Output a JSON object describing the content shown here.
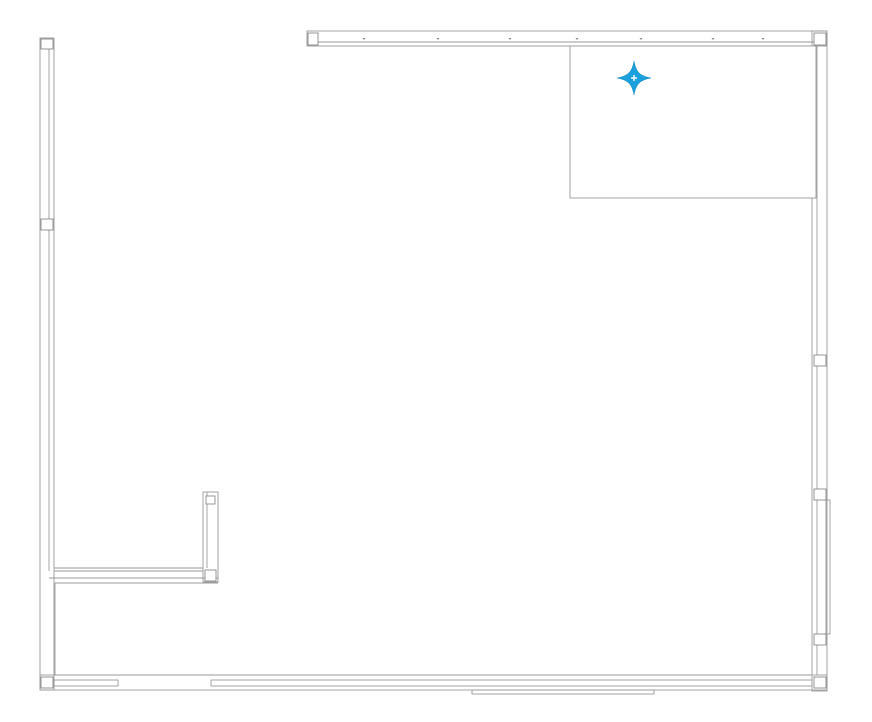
{
  "drawing": {
    "wall_color": "#9a9a9a",
    "column_color": "#8a8a8a",
    "background_color": "#ffffff",
    "origin_marker": {
      "icon": "compass-star-icon",
      "color": "#1aa0dc"
    },
    "top_beam_marker_count": 8,
    "column_count": 10
  }
}
